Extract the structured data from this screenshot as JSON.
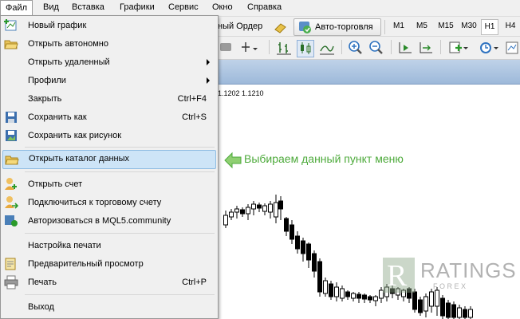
{
  "menubar": {
    "items": [
      "Файл",
      "Вид",
      "Вставка",
      "Графики",
      "Сервис",
      "Окно",
      "Справка"
    ]
  },
  "toolbar": {
    "new_order_label": "ный Ордер",
    "autotrade_label": "Авто-торговля",
    "timeframes": [
      "M1",
      "M5",
      "M15",
      "M30",
      "H1",
      "H4"
    ],
    "selected_timeframe": "H1"
  },
  "chart": {
    "price_text": "1.1202 1.1210"
  },
  "file_menu": {
    "items": [
      {
        "label": "Новый график",
        "shortcut": "",
        "submenu": false,
        "icon": "new-chart-icon"
      },
      {
        "label": "Открыть автономно",
        "shortcut": "",
        "submenu": false,
        "icon": "open-folder-icon"
      },
      {
        "label": "Открыть удаленный",
        "shortcut": "",
        "submenu": true,
        "icon": ""
      },
      {
        "label": "Профили",
        "shortcut": "",
        "submenu": true,
        "icon": ""
      },
      {
        "label": "Закрыть",
        "shortcut": "Ctrl+F4",
        "submenu": false,
        "icon": ""
      },
      {
        "label": "Сохранить как",
        "shortcut": "Ctrl+S",
        "submenu": false,
        "icon": "save-icon"
      },
      {
        "label": "Сохранить как рисунок",
        "shortcut": "",
        "submenu": false,
        "icon": "save-picture-icon"
      },
      {
        "label": "Открыть каталог данных",
        "shortcut": "",
        "submenu": false,
        "icon": "folder-icon"
      },
      {
        "label": "Открыть счет",
        "shortcut": "",
        "submenu": false,
        "icon": "user-add-icon"
      },
      {
        "label": "Подключиться к торговому счету",
        "shortcut": "",
        "submenu": false,
        "icon": "user-connect-icon"
      },
      {
        "label": "Авторизоваться в MQL5.community",
        "shortcut": "",
        "submenu": false,
        "icon": "mql5-icon"
      },
      {
        "label": "Настройка печати",
        "shortcut": "",
        "submenu": false,
        "icon": ""
      },
      {
        "label": "Предварительный просмотр",
        "shortcut": "",
        "submenu": false,
        "icon": "print-preview-icon"
      },
      {
        "label": "Печать",
        "shortcut": "Ctrl+P",
        "submenu": false,
        "icon": "printer-icon"
      },
      {
        "label": "Выход",
        "shortcut": "",
        "submenu": false,
        "icon": ""
      }
    ]
  },
  "annotation": {
    "text": "Выбираем данный пункт меню",
    "color": "#4daa3b"
  },
  "watermark": {
    "title": "RATINGS",
    "subtitle": "F O R E X"
  },
  "colors": {
    "menu_highlight": "#cde4f7",
    "chart_band": "#9db9da",
    "candle": "#000000"
  }
}
